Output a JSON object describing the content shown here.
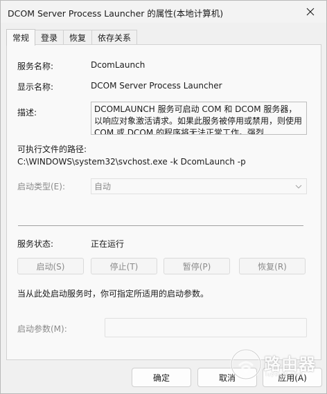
{
  "window": {
    "title": "DCOM Server Process Launcher 的属性(本地计算机)"
  },
  "tabs": [
    {
      "label": "常规",
      "active": true
    },
    {
      "label": "登录",
      "active": false
    },
    {
      "label": "恢复",
      "active": false
    },
    {
      "label": "依存关系",
      "active": false
    }
  ],
  "general": {
    "service_name_label": "服务名称:",
    "service_name": "DcomLaunch",
    "display_name_label": "显示名称:",
    "display_name": "DCOM Server Process Launcher",
    "description_label": "描述:",
    "description": "DCOMLAUNCH 服务可启动 COM 和 DCOM 服务器，以响应对象激活请求。如果此服务被停用或禁用，则使用 COM 或 DCOM 的程序将无法正常工作。强烈",
    "exe_path_label": "可执行文件的路径:",
    "exe_path": "C:\\WINDOWS\\system32\\svchost.exe -k DcomLaunch -p",
    "startup_type_label": "启动类型(E):",
    "startup_type_value": "自动",
    "status_label": "服务状态:",
    "status_value": "正在运行",
    "buttons": {
      "start": "启动(S)",
      "stop": "停止(T)",
      "pause": "暂停(P)",
      "resume": "恢复(R)"
    },
    "hint": "当从此处启动服务时，你可指定所适用的启动参数。",
    "start_params_label": "启动参数(M):",
    "start_params_value": ""
  },
  "footer": {
    "ok": "确定",
    "cancel": "取消",
    "apply": "应用(A)"
  },
  "watermark": {
    "text": "路由器",
    "sub": "luyouqi.com"
  }
}
